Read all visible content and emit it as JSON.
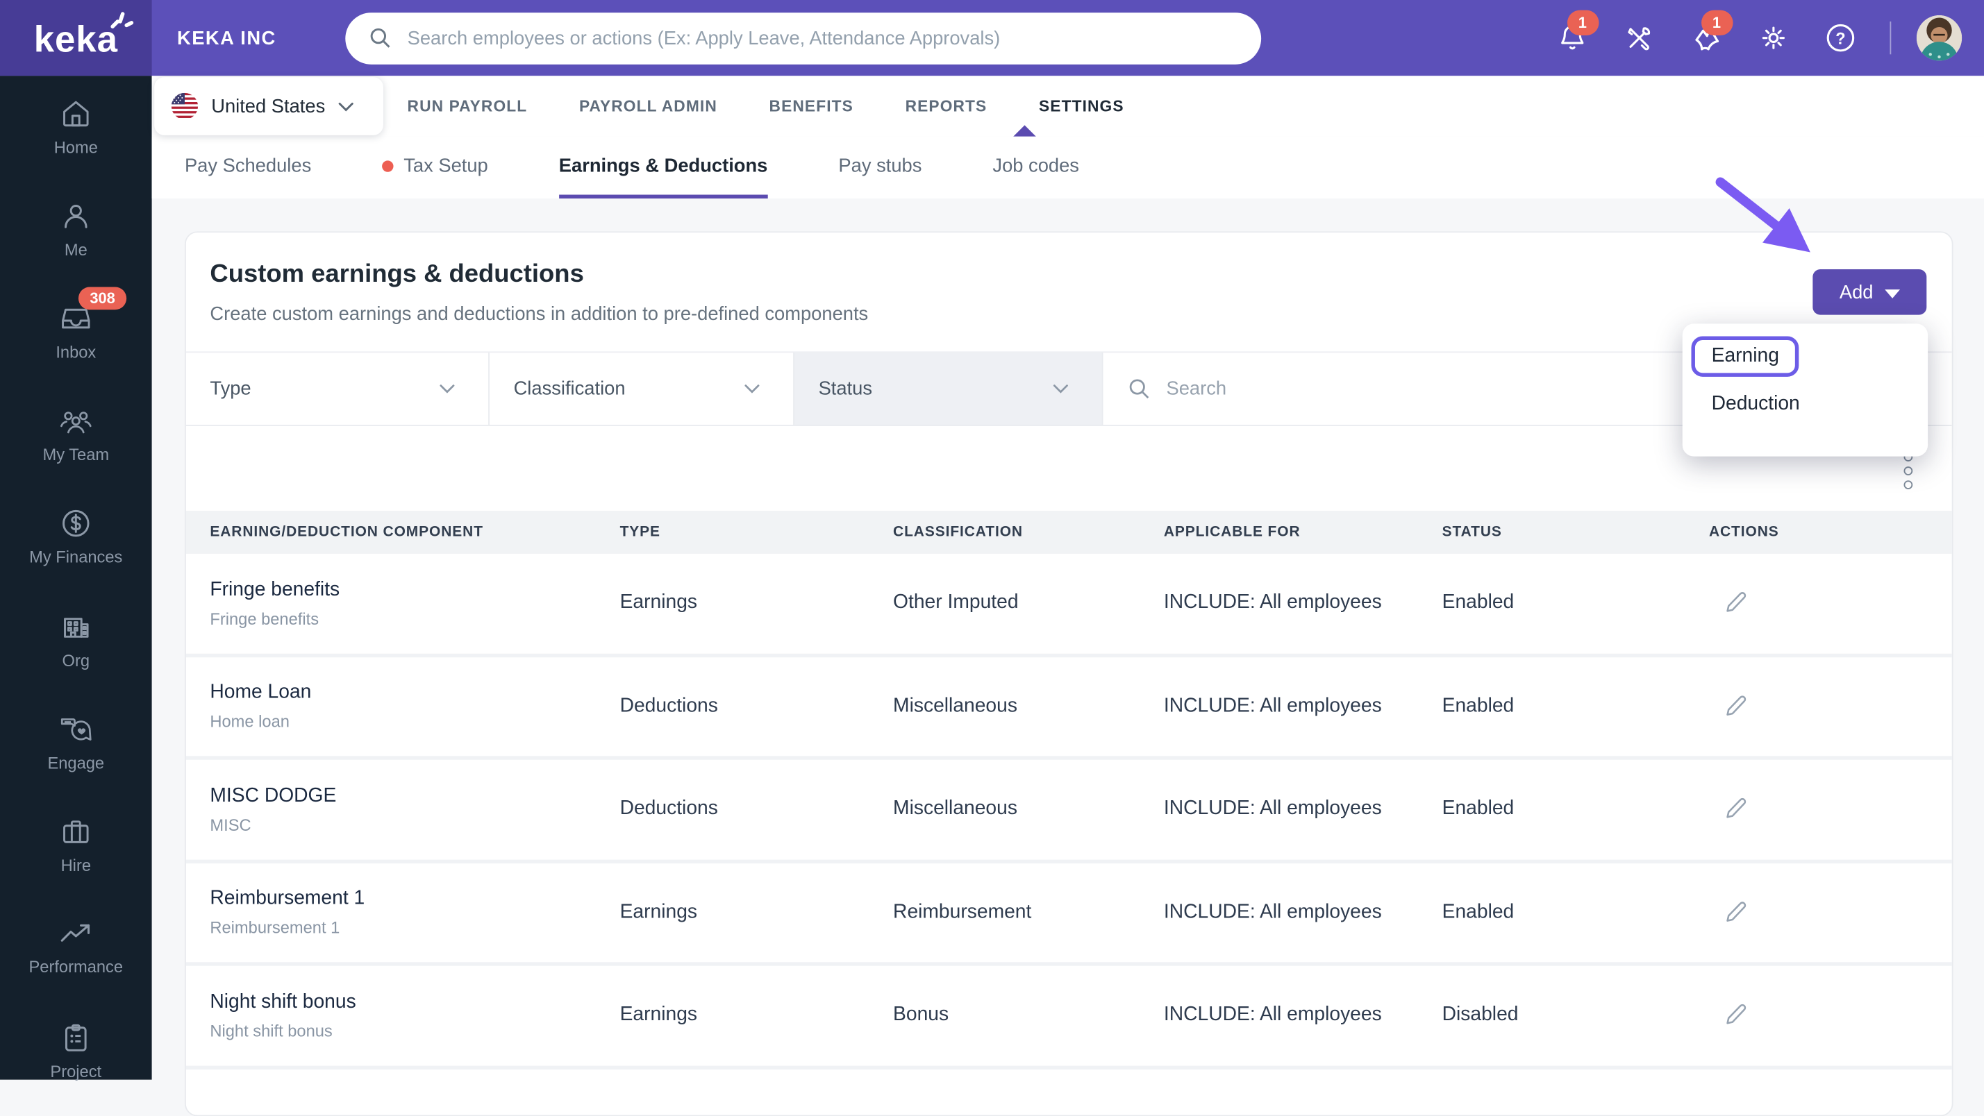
{
  "topbar": {
    "logo_text": "keka",
    "company_name": "KEKA INC",
    "search_placeholder": "Search employees or actions (Ex: Apply Leave, Attendance Approvals)",
    "notifications_badge": "1",
    "announcements_badge": "1"
  },
  "sidebar": {
    "items": [
      {
        "label": "Home"
      },
      {
        "label": "Me"
      },
      {
        "label": "Inbox",
        "badge": "308"
      },
      {
        "label": "My Team"
      },
      {
        "label": "My Finances"
      },
      {
        "label": "Org"
      },
      {
        "label": "Engage"
      },
      {
        "label": "Hire"
      },
      {
        "label": "Performance"
      },
      {
        "label": "Project"
      }
    ]
  },
  "module_nav": {
    "country": "United States",
    "tabs": [
      "RUN PAYROLL",
      "PAYROLL ADMIN",
      "BENEFITS",
      "REPORTS",
      "SETTINGS"
    ],
    "active_tab": "SETTINGS"
  },
  "sub_nav": {
    "tabs": [
      "Pay Schedules",
      "Tax Setup",
      "Earnings & Deductions",
      "Pay stubs",
      "Job codes"
    ],
    "active_tab": "Earnings & Deductions"
  },
  "panel": {
    "title": "Custom earnings & deductions",
    "subtitle": "Create custom earnings and deductions in addition to pre-defined components",
    "add_button": "Add",
    "add_menu": [
      "Earning",
      "Deduction"
    ],
    "highlighted_menu_item": "Earning"
  },
  "filters": {
    "type_label": "Type",
    "classification_label": "Classification",
    "status_label": "Status",
    "search_placeholder": "Search"
  },
  "table": {
    "headers": [
      "EARNING/DEDUCTION COMPONENT",
      "TYPE",
      "CLASSIFICATION",
      "APPLICABLE FOR",
      "STATUS",
      "ACTIONS"
    ],
    "rows": [
      {
        "name": "Fringe benefits",
        "code": "Fringe benefits",
        "type": "Earnings",
        "classification": "Other Imputed",
        "applicable_for": "INCLUDE: All employees",
        "status": "Enabled"
      },
      {
        "name": "Home Loan",
        "code": "Home loan",
        "type": "Deductions",
        "classification": "Miscellaneous",
        "applicable_for": "INCLUDE: All employees",
        "status": "Enabled"
      },
      {
        "name": "MISC DODGE",
        "code": "MISC",
        "type": "Deductions",
        "classification": "Miscellaneous",
        "applicable_for": "INCLUDE: All employees",
        "status": "Enabled"
      },
      {
        "name": "Reimbursement 1",
        "code": "Reimbursement 1",
        "type": "Earnings",
        "classification": "Reimbursement",
        "applicable_for": "INCLUDE: All employees",
        "status": "Enabled"
      },
      {
        "name": "Night shift bonus",
        "code": "Night shift bonus",
        "type": "Earnings",
        "classification": "Bonus",
        "applicable_for": "INCLUDE: All employees",
        "status": "Disabled"
      }
    ]
  },
  "colors": {
    "brand_purple": "#5C50B9",
    "logo_purple": "#473C96",
    "sidebar_navy": "#14202C",
    "accent_purple": "#5B4BB0",
    "add_button_purple": "#5B4CB0",
    "highlight_outline": "#6C5CE7",
    "annotation_arrow": "#7B5BF2",
    "badge_red": "#EA6254",
    "page_background": "#F6F7F9",
    "table_header_bg": "#F1F3F5"
  }
}
